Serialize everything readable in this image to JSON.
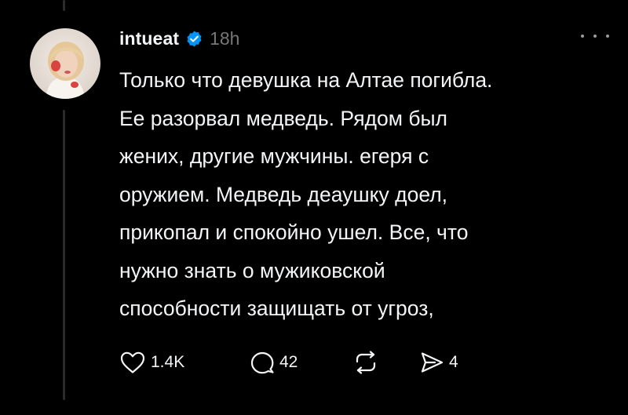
{
  "post": {
    "username": "intueat",
    "time": "18h",
    "lines": [
      "Только что девушка на Алтае погибла.",
      "Ее разорвал медведь. Рядом был",
      "жених, другие мужчины. егеря с",
      "оружием. Медведь деаушку доел,",
      "прикопал и спокойно ушел. Все, что",
      "нужно знать о мужиковской",
      "способности защищать от угроз,"
    ]
  },
  "actions": {
    "likes": "1.4K",
    "replies": "42",
    "shares": "4"
  },
  "icons": {
    "verified": "verified-badge-icon",
    "more": "more-dots-icon",
    "like": "heart-icon",
    "reply": "comment-bubble-icon",
    "repost": "repost-icon",
    "share": "send-icon"
  },
  "colors": {
    "background": "#000000",
    "text": "#f3f5f7",
    "muted": "#777777",
    "verified": "#0095f6"
  }
}
